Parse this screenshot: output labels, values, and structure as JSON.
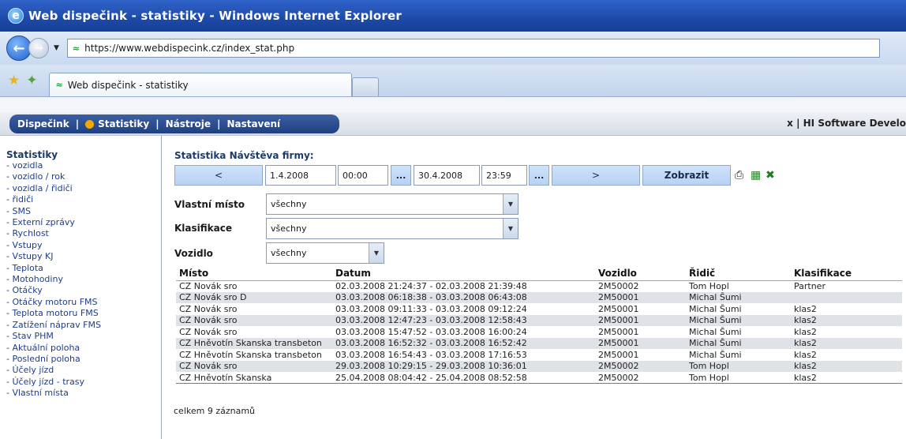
{
  "window": {
    "title": "Web dispečink - statistiky - Windows Internet Explorer"
  },
  "browser": {
    "url": "https://www.webdispecink.cz/index_stat.php",
    "tab_title": "Web dispečink - statistiky"
  },
  "app_menu": {
    "items": [
      "Dispečink",
      "Statistiky",
      "Nástroje",
      "Nastavení"
    ],
    "separator": "|",
    "top_right": "x  |  HI Software Develo"
  },
  "sidebar": {
    "title": "Statistiky",
    "items": [
      "- vozidla",
      "- vozidlo / rok",
      "- vozidla / řidiči",
      "- řidiči",
      "- SMS",
      "- Externí zprávy",
      "- Rychlost",
      "- Vstupy",
      "- Vstupy KJ",
      "- Teplota",
      "- Motohodiny",
      "- Otáčky",
      "- Otáčky motoru FMS",
      "- Teplota motoru FMS",
      "- Zatížení náprav FMS",
      "- Stav PHM",
      "- Aktuální poloha",
      "- Poslední poloha",
      "- Účely jízd",
      "- Účely jízd - trasy",
      "- Vlastní místa"
    ]
  },
  "main": {
    "title": "Statistika Návštěva firmy:",
    "date_from": "1.4.2008",
    "time_from": "00:00",
    "date_to": "30.4.2008",
    "time_to": "23:59",
    "prev_label": "<",
    "next_label": ">",
    "dots_label": "...",
    "show_label": "Zobrazit",
    "filters": {
      "place_label": "Vlastní místo",
      "place_value": "všechny",
      "class_label": "Klasifikace",
      "class_value": "všechny",
      "vehicle_label": "Vozidlo",
      "vehicle_value": "všechny"
    },
    "table": {
      "headers": [
        "Místo",
        "Datum",
        "Vozidlo",
        "Řidič",
        "Klasifikace"
      ],
      "rows": [
        [
          "CZ Novák sro",
          "02.03.2008 21:24:37 - 02.03.2008 21:39:48",
          "2M50002",
          "Tom Hopl",
          "Partner"
        ],
        [
          "CZ Novák sro D",
          "03.03.2008 06:18:38 - 03.03.2008 06:43:08",
          "2M50001",
          "Michal Šumi",
          ""
        ],
        [
          "CZ Novák sro",
          "03.03.2008 09:11:33 - 03.03.2008 09:12:24",
          "2M50001",
          "Michal Šumi",
          "klas2"
        ],
        [
          "CZ Novák sro",
          "03.03.2008 12:47:23 - 03.03.2008 12:58:43",
          "2M50001",
          "Michal Šumi",
          "klas2"
        ],
        [
          "CZ Novák sro",
          "03.03.2008 15:47:52 - 03.03.2008 16:00:24",
          "2M50001",
          "Michal Šumi",
          "klas2"
        ],
        [
          "CZ Hněvotín Skanska transbeton",
          "03.03.2008 16:52:32 - 03.03.2008 16:52:42",
          "2M50001",
          "Michal Šumi",
          "klas2"
        ],
        [
          "CZ Hněvotín Skanska transbeton",
          "03.03.2008 16:54:43 - 03.03.2008 17:16:53",
          "2M50001",
          "Michal Šumi",
          "klas2"
        ],
        [
          "CZ Novák sro",
          "29.03.2008 10:29:15 - 29.03.2008 10:36:01",
          "2M50002",
          "Tom Hopl",
          "klas2"
        ],
        [
          "CZ Hněvotín Skanska",
          "25.04.2008 08:04:42 - 25.04.2008 08:52:58",
          "2M50002",
          "Tom Hopl",
          "klas2"
        ]
      ]
    },
    "record_count": "celkem 9 záznamů"
  }
}
